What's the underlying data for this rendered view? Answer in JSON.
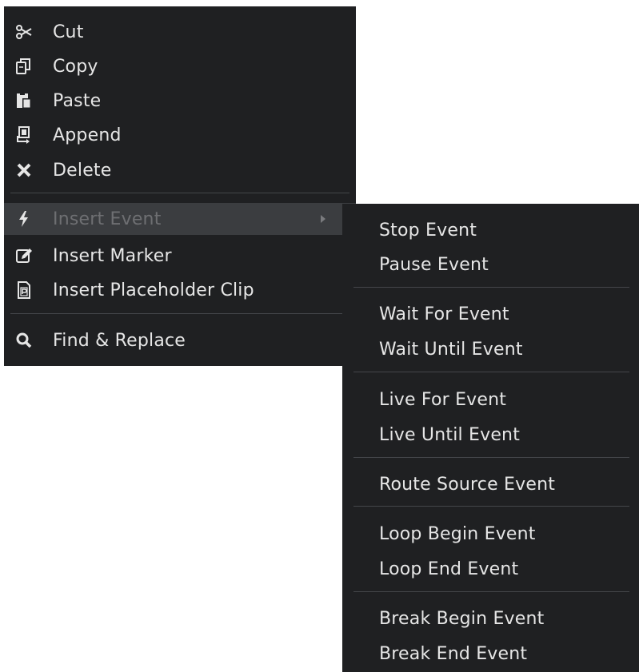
{
  "main_menu": {
    "items": [
      {
        "label": "Cut",
        "icon": "scissors-icon"
      },
      {
        "label": "Copy",
        "icon": "copy-icon"
      },
      {
        "label": "Paste",
        "icon": "paste-icon"
      },
      {
        "label": "Append",
        "icon": "append-icon"
      },
      {
        "label": "Delete",
        "icon": "delete-x-icon"
      },
      {
        "label": "Insert Event",
        "icon": "lightning-icon",
        "state": "highlighted",
        "has_submenu": true
      },
      {
        "label": "Insert Marker",
        "icon": "edit-marker-icon"
      },
      {
        "label": "Insert Placeholder Clip",
        "icon": "placeholder-clip-icon"
      },
      {
        "label": "Find & Replace",
        "icon": "magnifier-icon"
      }
    ]
  },
  "submenu": {
    "items": [
      {
        "label": "Stop Event"
      },
      {
        "label": "Pause Event"
      },
      {
        "label": "Wait For Event"
      },
      {
        "label": "Wait Until Event"
      },
      {
        "label": "Live For Event"
      },
      {
        "label": "Live Until Event"
      },
      {
        "label": "Route Source Event"
      },
      {
        "label": "Loop Begin Event"
      },
      {
        "label": "Loop End Event"
      },
      {
        "label": "Break Begin Event"
      },
      {
        "label": "Break End Event"
      }
    ]
  },
  "colors": {
    "menu_background": "#1f2022",
    "text": "#e6e6e6",
    "highlight_background": "#3b3d40",
    "disabled_text": "#6e6f72",
    "separator": "#44464a"
  }
}
